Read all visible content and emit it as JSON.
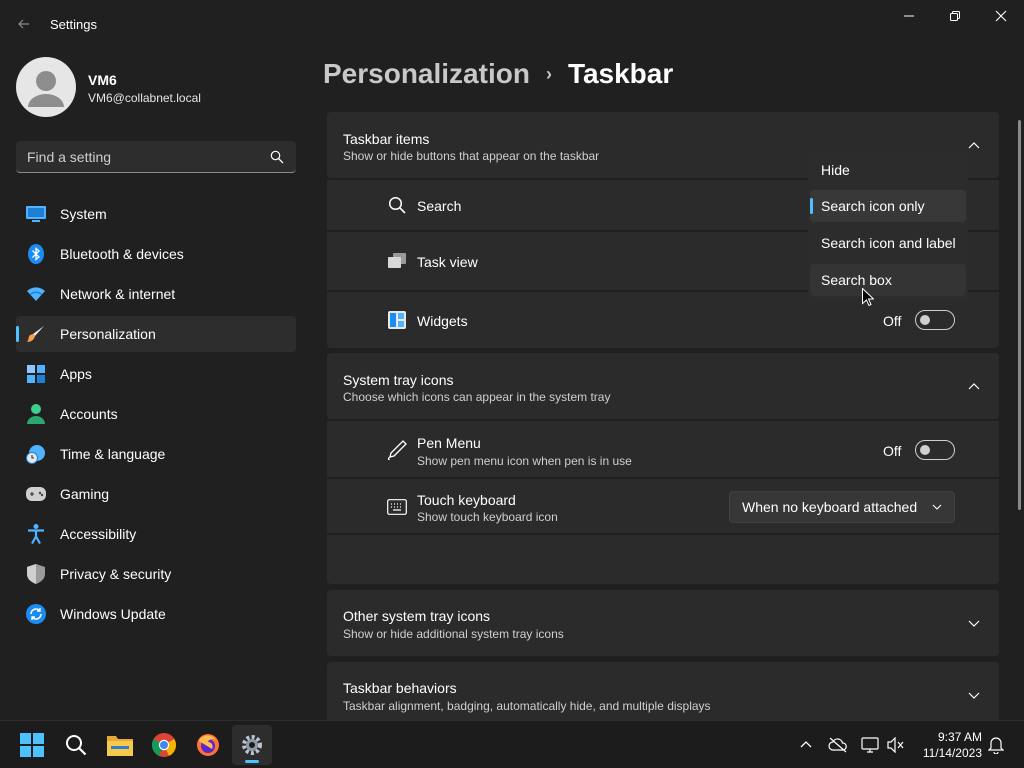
{
  "window": {
    "title": "Settings"
  },
  "user": {
    "name": "VM6",
    "email": "VM6@collabnet.local"
  },
  "search": {
    "placeholder": "Find a setting"
  },
  "sidebar": {
    "items": [
      {
        "label": "System",
        "icon": "system-icon"
      },
      {
        "label": "Bluetooth & devices",
        "icon": "bluetooth-icon"
      },
      {
        "label": "Network & internet",
        "icon": "wifi-icon"
      },
      {
        "label": "Personalization",
        "icon": "brush-icon",
        "selected": true
      },
      {
        "label": "Apps",
        "icon": "apps-icon"
      },
      {
        "label": "Accounts",
        "icon": "accounts-icon"
      },
      {
        "label": "Time & language",
        "icon": "clock-globe-icon"
      },
      {
        "label": "Gaming",
        "icon": "gamepad-icon"
      },
      {
        "label": "Accessibility",
        "icon": "accessibility-icon"
      },
      {
        "label": "Privacy & security",
        "icon": "shield-icon"
      },
      {
        "label": "Windows Update",
        "icon": "update-icon"
      }
    ]
  },
  "breadcrumb": {
    "parent": "Personalization",
    "separator": "›",
    "current": "Taskbar"
  },
  "taskbar_items": {
    "title": "Taskbar items",
    "description": "Show or hide buttons that appear on the taskbar",
    "rows": [
      {
        "label": "Search",
        "icon": "search-icon"
      },
      {
        "label": "Task view",
        "icon": "task-view-icon"
      },
      {
        "label": "Widgets",
        "icon": "widgets-icon",
        "state": "Off"
      }
    ]
  },
  "search_dropdown": {
    "options": [
      "Hide",
      "Search icon only",
      "Search icon and label",
      "Search box"
    ],
    "selected": "Search icon only",
    "hovered": "Search box"
  },
  "system_tray": {
    "title": "System tray icons",
    "description": "Choose which icons can appear in the system tray",
    "pen_menu": {
      "label": "Pen Menu",
      "description": "Show pen menu icon when pen is in use",
      "state": "Off"
    },
    "touch_keyboard": {
      "label": "Touch keyboard",
      "description": "Show touch keyboard icon",
      "value": "When no keyboard attached"
    }
  },
  "other_tray": {
    "title": "Other system tray icons",
    "description": "Show or hide additional system tray icons"
  },
  "behaviors": {
    "title": "Taskbar behaviors",
    "description": "Taskbar alignment, badging, automatically hide, and multiple displays"
  },
  "taskbar": {
    "apps": [
      "start-icon",
      "search-icon",
      "file-explorer-icon",
      "chrome-icon",
      "firefox-icon",
      "settings-icon"
    ],
    "time": "9:37 AM",
    "date": "11/14/2023"
  },
  "colors": {
    "accent": "#4cc2ff",
    "background": "#202020",
    "card": "#2b2b2b"
  }
}
